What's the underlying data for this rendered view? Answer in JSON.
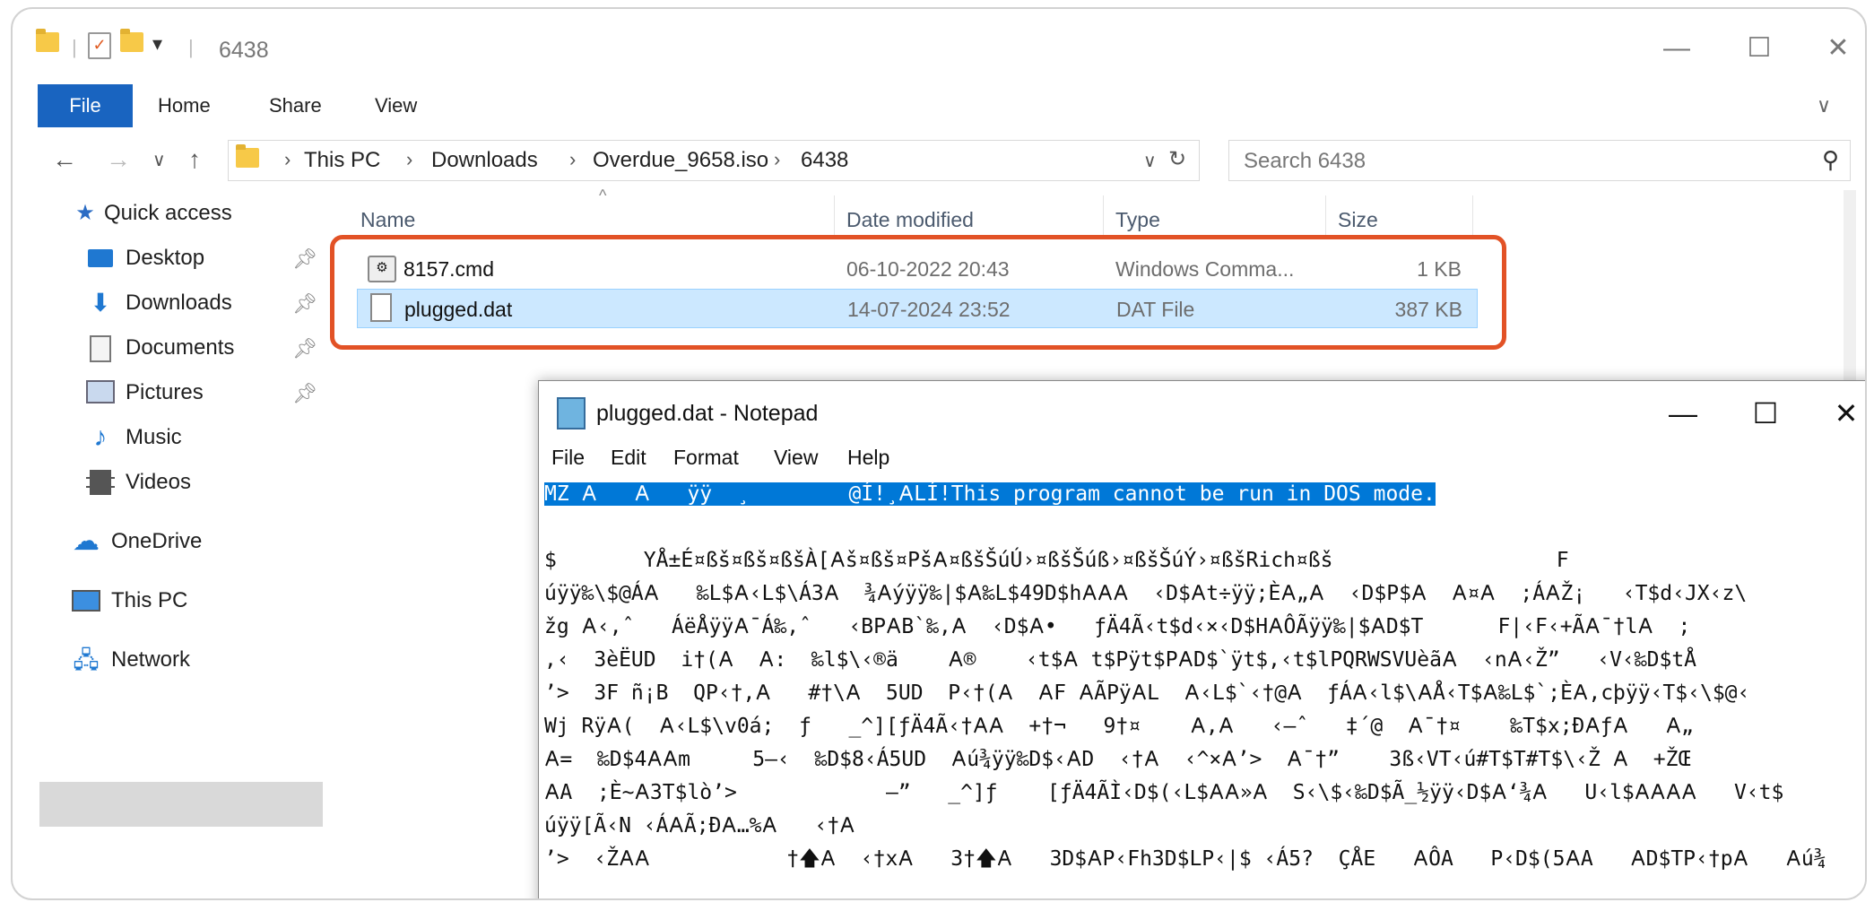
{
  "explorer": {
    "window_title": "6438",
    "ribbon_tabs": [
      "File",
      "Home",
      "Share",
      "View"
    ],
    "breadcrumbs": [
      "This PC",
      "Downloads",
      "Overdue_9658.iso",
      "6438"
    ],
    "search_placeholder": "Search 6438",
    "columns": [
      "Name",
      "Date modified",
      "Type",
      "Size"
    ],
    "files": [
      {
        "name": "8157.cmd",
        "date": "06-10-2022 20:43",
        "type": "Windows Comma...",
        "size": "1 KB",
        "icon": "cmd-file-icon"
      },
      {
        "name": "plugged.dat",
        "date": "14-07-2024 23:52",
        "type": "DAT File",
        "size": "387 KB",
        "icon": "dat-file-icon"
      }
    ],
    "sidebar": {
      "quick_access": "Quick access",
      "items": [
        "Desktop",
        "Downloads",
        "Documents",
        "Pictures",
        "Music",
        "Videos"
      ],
      "onedrive": "OneDrive",
      "this_pc": "This PC",
      "network": "Network"
    },
    "highlight_color": "#e25226",
    "accent_color": "#1964c0"
  },
  "notepad": {
    "title": "plugged.dat - Notepad",
    "menu": [
      "File",
      "Edit",
      "Format",
      "View",
      "Help"
    ],
    "selected_line": "MZ 𐌀   𐌀   ÿÿ  ¸        @Í!¸𐌀LÍ!This program cannot be run in DOS mode.",
    "lines": [
      "",
      "$       YÅ±É¤ßš¤ßš¤ßšÀ[𐌀š¤ßš¤Pš𐌀¤ßšŠúÚ›¤ßšŠúß›¤ßšŠúÝ›¤ßšRich¤ßš                  F",
      "úÿÿ‰\\$@Á𐌀   ‰L$𐌀‹L$\\Á3𐌀  ¾𐌀ýÿÿ‰|$𐌀‰L$49D$h𐌀𐌀𐌀  ‹D$𐌀t÷ÿÿ;È𐌀„𐌀  ‹D$P$𐌀  𐌀¤𐌀  ;Á𐌀Ž¡   ‹T$d‹JX‹z\\",
      "žg 𐌀‹,ˆ   ÁëÅÿÿ𐌀¯Á‰,ˆ   ‹BP𐌀B`‰,𐌀  ‹D$𐌀•   ƒÄ4Ã‹t$d‹×‹D$H𐌀ÔÃÿÿ‰|$𐌀D$T      F|‹F‹+Ã𐌀¯†l𐌀  ;",
      ",‹  3èËUD  i†(𐌀  𐌀:  ‰l$\\‹®ä    𐌀®    ‹t$𐌀 t$Pÿt$P𐌀D$`ÿt$,‹t$lPQRWSVUèã𐌀  ‹n𐌀‹Ž”   ‹V‹‰D$tÅ",
      "’>  3F ñ¡B  QP‹†,𐌀   #†\\𐌀  5UD  P‹†(𐌀  𐌀F 𐌀ÃPÿ𐌀L  𐌀‹L$`‹†@𐌀  ƒÁ𐌀‹l$\\𐌀Å‹T$𐌀‰L$`;È𐌀,cþÿÿ‹T$‹\\$@‹",
      "Wj Rÿ𐌀(  𐌀‹L$\\v0á;  ƒ   _^][ƒÄ4Ã‹†𐌀𐌀  +†¬   9†¤    𐌀,𐌀   ‹–ˆ   ‡´@  𐌀¯†¤    ‰T$x;Ð𐌀ƒ𐌀   𐌀„",
      "𐌀=  ‰D$4𐌀𐌀m     5–‹  ‰D$8‹Á5UD  𐌀ú¾ÿÿ‰D$‹𐌀D  ‹†𐌀  ‹^×𐌀’>  𐌀¯†”    3ß‹VT‹ú#T$T#T$\\‹Ž 𐌀  +ŽŒ",
      "𐌀A  ;È~𐌀3T$lò’>            –”   _^]ƒ    [ƒÄ4ÃÌ‹D$(‹L$𐌀𐌀»𐌀  S‹\\$‹‰D$Ã_½ÿÿ‹D$𐌀‘¾𐌀   U‹l$𐌀𐌀𐌀𐌀   V‹t$",
      "úÿÿ[Ã‹N ‹Á𐌀Ã;Ð𐌀…%𐌀   ‹†𐌀",
      "’>  ‹Ž𐌀𐌀           †🡅𐌀  ‹†x𐌀   3†🡅𐌀   3D$𐌀P‹Fh3D$LP‹|$ ‹Á5?  ÇÅE   𐌀ÔA   P‹D$(5𐌀A   𐌀D$TP‹†p𐌀   𐌀ú¾"
    ]
  }
}
